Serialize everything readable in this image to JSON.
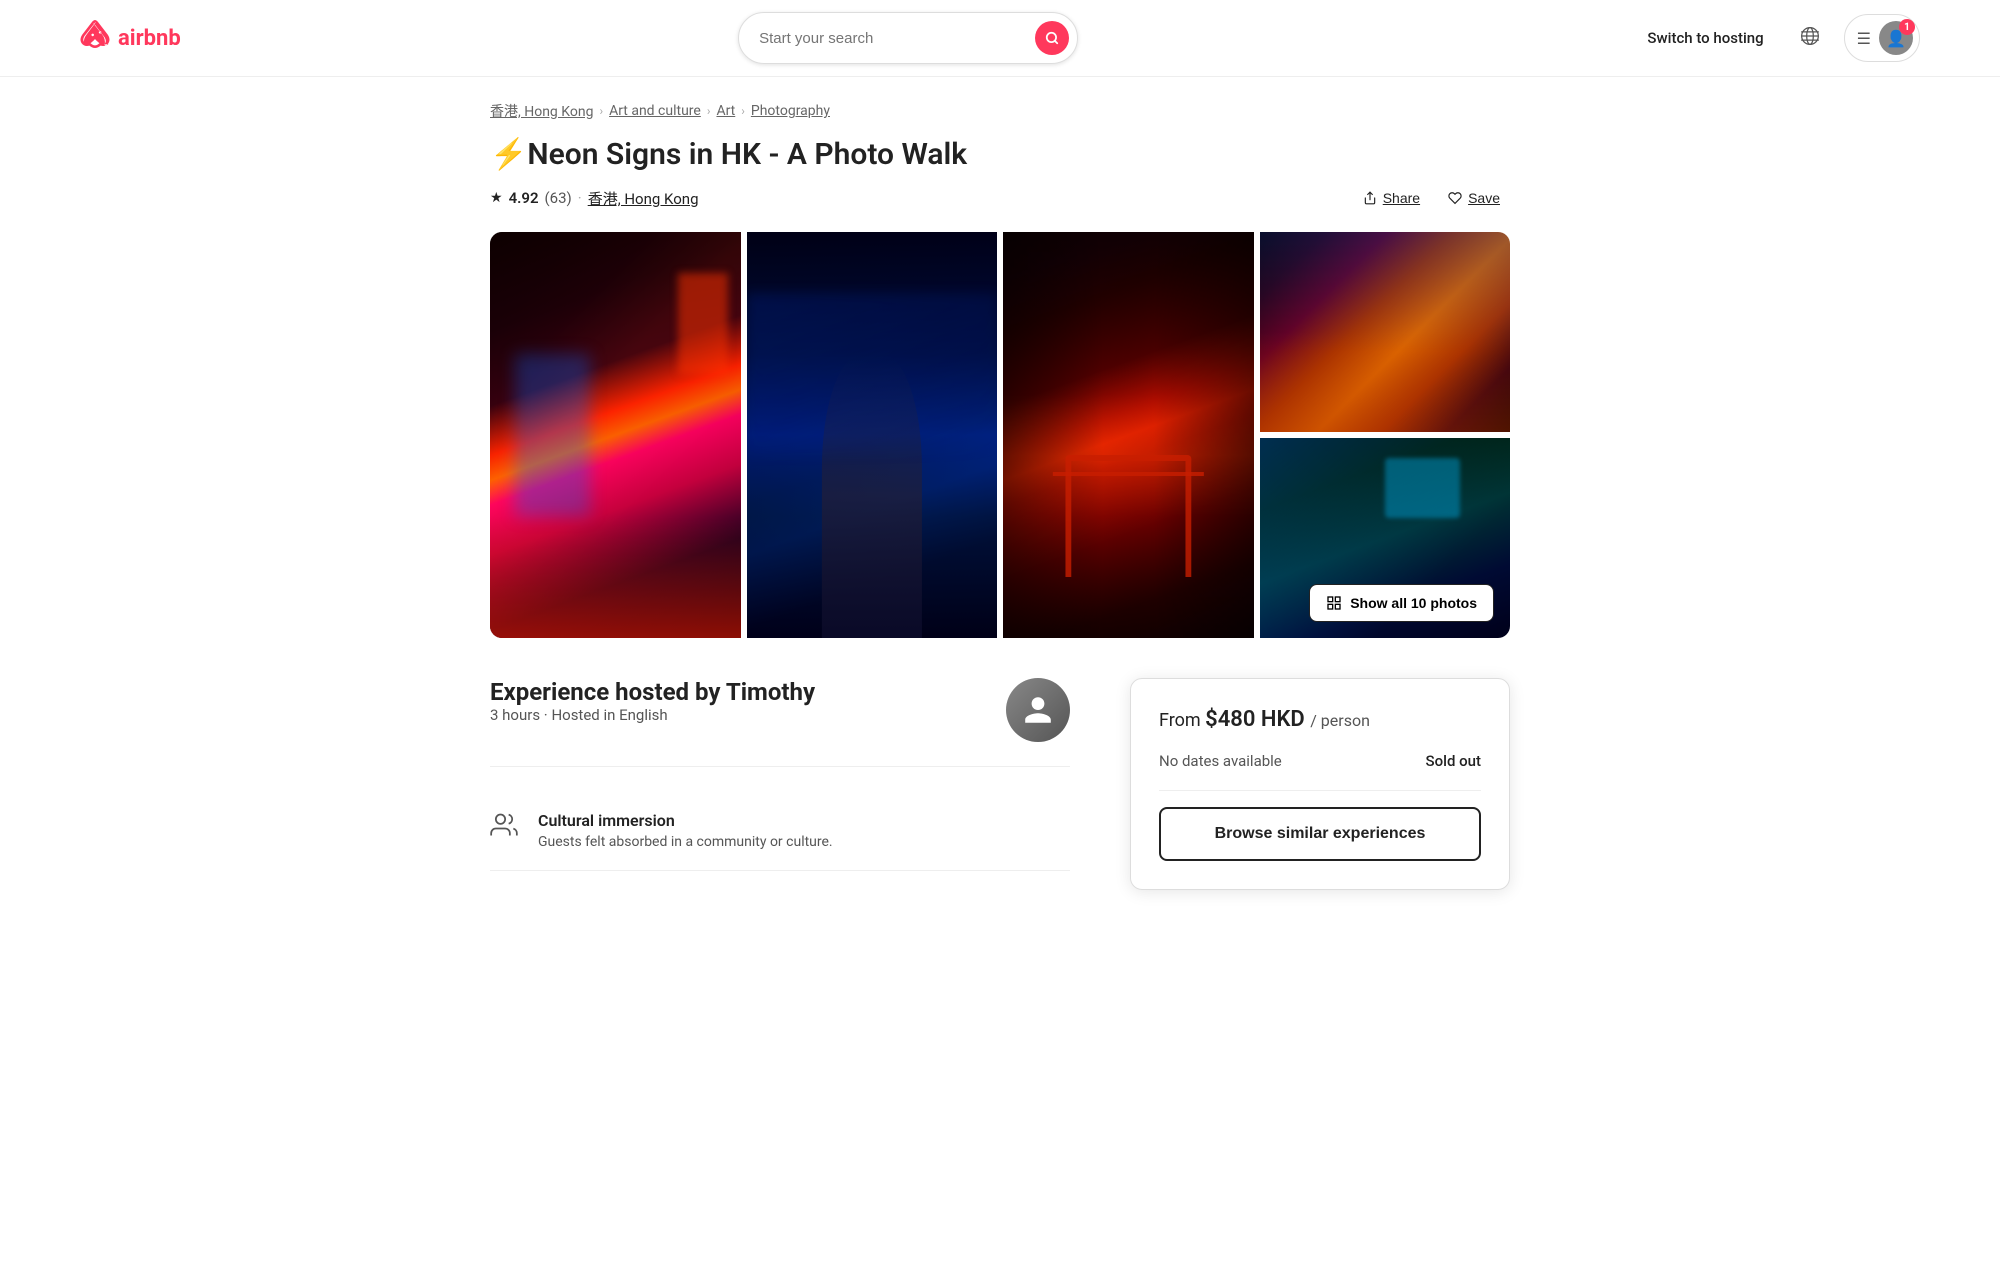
{
  "header": {
    "logo_text": "airbnb",
    "search_placeholder": "Start your search",
    "switch_hosting": "Switch to hosting",
    "notification_count": "1"
  },
  "breadcrumb": {
    "items": [
      {
        "label": "香港, Hong Kong",
        "href": "#"
      },
      {
        "label": "Art and culture",
        "href": "#"
      },
      {
        "label": "Art",
        "href": "#"
      },
      {
        "label": "Photography",
        "href": "#"
      }
    ]
  },
  "experience": {
    "title": "⚡Neon Signs in HK - A Photo Walk",
    "rating": "4.92",
    "review_count": "(63)",
    "location": "香港, Hong Kong",
    "share_label": "Share",
    "save_label": "Save",
    "host_name": "Timothy",
    "duration": "3 hours",
    "language": "Hosted in English",
    "price": "$480 HKD",
    "per_person": "/ person",
    "from_label": "From",
    "no_dates_label": "No dates available",
    "sold_out_label": "Sold out",
    "browse_similar_label": "Browse similar experiences",
    "show_all_photos": "Show all 10 photos",
    "feature": {
      "title": "Cultural immersion",
      "description": "Guests felt absorbed in a community or culture."
    }
  }
}
